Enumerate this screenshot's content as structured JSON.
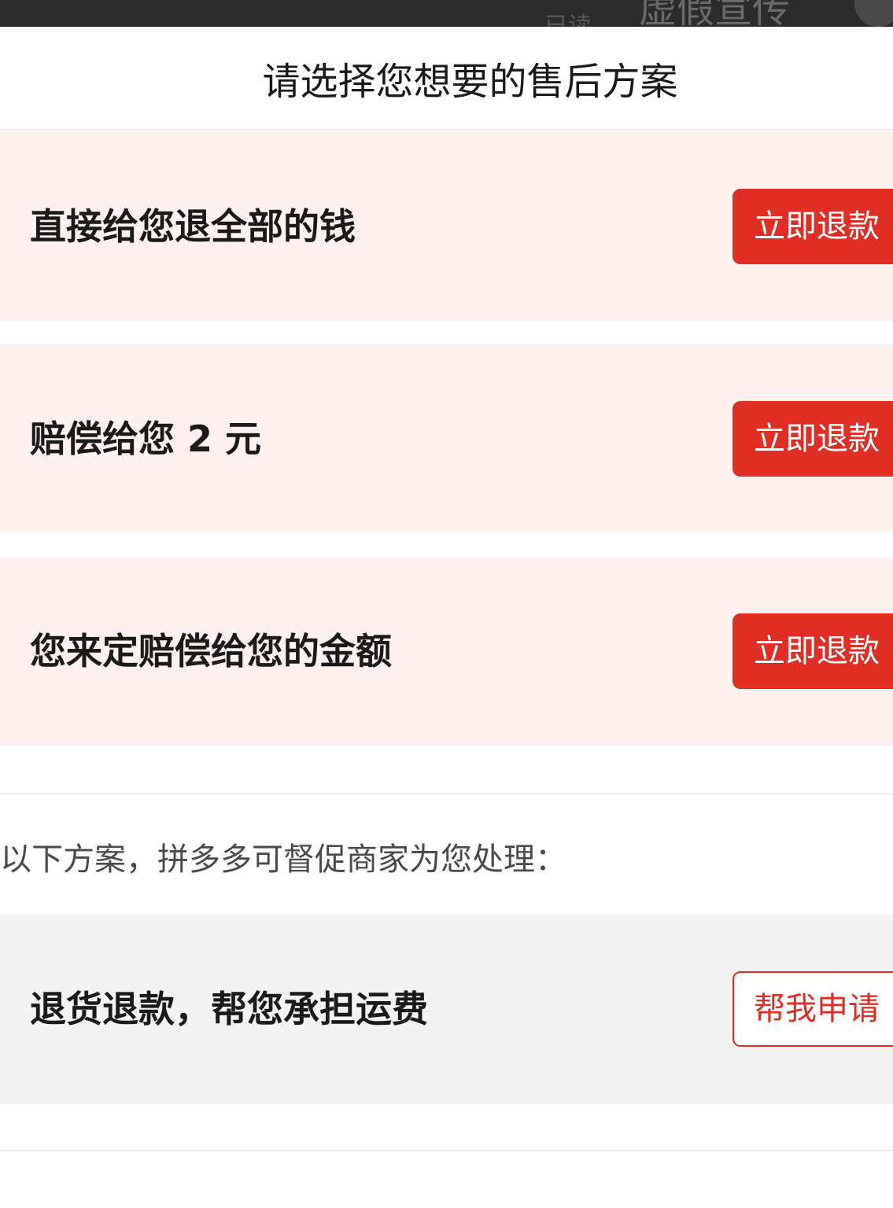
{
  "background": {
    "small_text": "已读",
    "large_text": "虚假宣传"
  },
  "sheet": {
    "title": "请选择您想要的售后方案"
  },
  "options": [
    {
      "label": "直接给您退全部的钱",
      "button": "立即退款"
    },
    {
      "label": "赔偿给您 2 元",
      "button": "立即退款"
    },
    {
      "label": "您来定赔偿给您的金额",
      "button": "立即退款"
    }
  ],
  "secondary": {
    "note": "以下方案，拼多多可督促商家为您处理：",
    "label": "退货退款，帮您承担运费",
    "button": "帮我申请"
  },
  "colors": {
    "accent": "#e02e24",
    "card_bg": "#fef1f0",
    "secondary_card_bg": "#f3f3f3"
  }
}
